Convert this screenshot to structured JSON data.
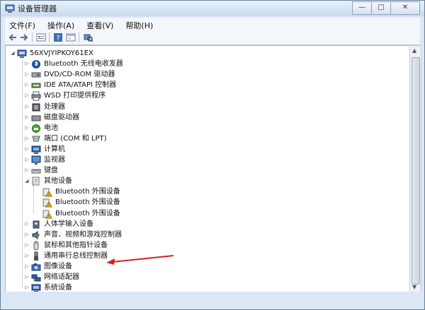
{
  "window": {
    "title": "设备管理器"
  },
  "window_controls": {
    "minimize": "—",
    "maximize": "□",
    "close": "✕"
  },
  "menu": [
    {
      "id": "file",
      "label": "文件(F)"
    },
    {
      "id": "action",
      "label": "操作(A)"
    },
    {
      "id": "view",
      "label": "查看(V)"
    },
    {
      "id": "help",
      "label": "帮助(H)"
    }
  ],
  "toolbar": [
    {
      "id": "back",
      "icon": "back-arrow-icon"
    },
    {
      "id": "forward",
      "icon": "forward-arrow-icon"
    },
    {
      "id": "properties",
      "icon": "properties-icon"
    },
    {
      "id": "help",
      "icon": "help-icon"
    },
    {
      "id": "show-hide",
      "icon": "show-hide-tree-icon"
    },
    {
      "id": "scan",
      "icon": "scan-hardware-icon"
    }
  ],
  "tree": {
    "root": "56XVJYIPKOY61EX",
    "items": [
      {
        "label": "Bluetooth 无线电收发器",
        "icon": "bluetooth-icon",
        "depth": 1,
        "expander": "▷"
      },
      {
        "label": "DVD/CD-ROM 驱动器",
        "icon": "disc-drive-icon",
        "depth": 1,
        "expander": "▷"
      },
      {
        "label": "IDE ATA/ATAPI 控制器",
        "icon": "ide-controller-icon",
        "depth": 1,
        "expander": "▷"
      },
      {
        "label": "WSD 打印提供程序",
        "icon": "printer-icon",
        "depth": 1,
        "expander": "▷"
      },
      {
        "label": "处理器",
        "icon": "processor-icon",
        "depth": 1,
        "expander": "▷"
      },
      {
        "label": "磁盘驱动器",
        "icon": "disk-drive-icon",
        "depth": 1,
        "expander": "▷"
      },
      {
        "label": "电池",
        "icon": "battery-icon",
        "depth": 1,
        "expander": "▷"
      },
      {
        "label": "端口 (COM 和 LPT)",
        "icon": "port-icon",
        "depth": 1,
        "expander": "▷"
      },
      {
        "label": "计算机",
        "icon": "computer-icon",
        "depth": 1,
        "expander": "▷"
      },
      {
        "label": "监视器",
        "icon": "monitor-icon",
        "depth": 1,
        "expander": "▷"
      },
      {
        "label": "键盘",
        "icon": "keyboard-icon",
        "depth": 1,
        "expander": "▷"
      },
      {
        "label": "其他设备",
        "icon": "other-devices-icon",
        "depth": 1,
        "expander": "◢"
      },
      {
        "label": "Bluetooth 外围设备",
        "icon": "warning-device-icon",
        "depth": 2,
        "expander": ""
      },
      {
        "label": "Bluetooth 外围设备",
        "icon": "warning-device-icon",
        "depth": 2,
        "expander": ""
      },
      {
        "label": "Bluetooth 外围设备",
        "icon": "warning-device-icon",
        "depth": 2,
        "expander": ""
      },
      {
        "label": "人体学输入设备",
        "icon": "hid-icon",
        "depth": 1,
        "expander": "▷"
      },
      {
        "label": "声音、视频和游戏控制器",
        "icon": "sound-icon",
        "depth": 1,
        "expander": "▷"
      },
      {
        "label": "鼠标和其他指针设备",
        "icon": "mouse-icon",
        "depth": 1,
        "expander": "▷"
      },
      {
        "label": "通用串行总线控制器",
        "icon": "usb-icon",
        "depth": 1,
        "expander": "▷"
      },
      {
        "label": "图像设备",
        "icon": "camera-icon",
        "depth": 1,
        "expander": "▷"
      },
      {
        "label": "网络适配器",
        "icon": "network-adapter-icon",
        "depth": 1,
        "expander": "▷"
      },
      {
        "label": "系统设备",
        "icon": "system-device-icon",
        "depth": 1,
        "expander": "▷"
      }
    ]
  },
  "colors": {
    "accent": "#d42020",
    "selection": "#3399ff"
  }
}
